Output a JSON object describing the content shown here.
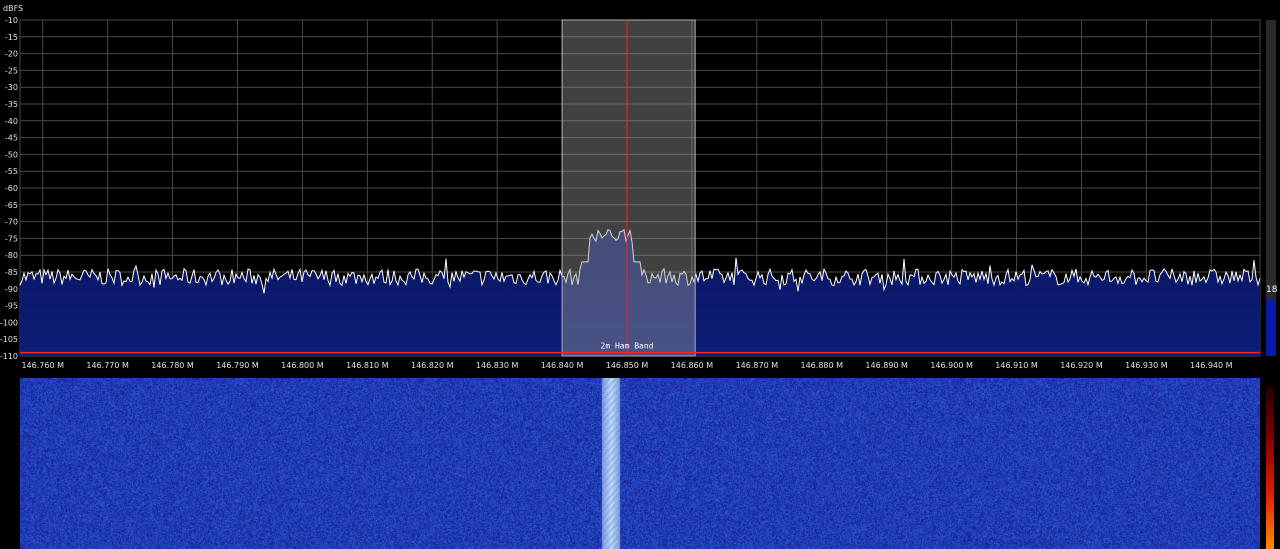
{
  "app": {
    "unit_label": "dBFS"
  },
  "spectrum": {
    "y_ticks": [
      "-10",
      "-15",
      "-20",
      "-25",
      "-30",
      "-35",
      "-40",
      "-45",
      "-50",
      "-55",
      "-60",
      "-65",
      "-70",
      "-75",
      "-80",
      "-85",
      "-90",
      "-95",
      "-100",
      "-105",
      "-110"
    ],
    "y_min": -110,
    "y_max": -10,
    "x_ticks": [
      "146.760 M",
      "146.770 M",
      "146.780 M",
      "146.790 M",
      "146.800 M",
      "146.810 M",
      "146.820 M",
      "146.830 M",
      "146.840 M",
      "146.850 M",
      "146.860 M",
      "146.870 M",
      "146.880 M",
      "146.890 M",
      "146.900 M",
      "146.910 M",
      "146.920 M",
      "146.930 M",
      "146.940 M"
    ],
    "x_tick_values": [
      146.76,
      146.77,
      146.78,
      146.79,
      146.8,
      146.81,
      146.82,
      146.83,
      146.84,
      146.85,
      146.86,
      146.87,
      146.88,
      146.89,
      146.9,
      146.91,
      146.92,
      146.93,
      146.94
    ],
    "x_min": 146.7565,
    "x_max": 146.9475,
    "noise_floor_dbfs": -86.5,
    "signal_center_mhz": 146.8475,
    "signal_peak_dbfs": -71,
    "vfo_frequency_mhz": 146.85,
    "filter_low_mhz": 146.84,
    "filter_high_mhz": 146.8605,
    "band_plan": {
      "label": "2m Ham Band",
      "level_dbfs": -109
    },
    "colors": {
      "grid": "#4a4a4a",
      "trace": "#ffffff",
      "fill_top": "#0a1560",
      "fill_bottom": "#0c1e78",
      "filter": "#8a8a8a",
      "vfo": "#ff2020",
      "band_line": "#ff2020"
    }
  },
  "snr_meter": {
    "value": "18",
    "level_fraction": 0.17
  },
  "waterfall": {
    "colors": {
      "background": "#1a2a98",
      "signal": "#cfe8ff"
    }
  }
}
